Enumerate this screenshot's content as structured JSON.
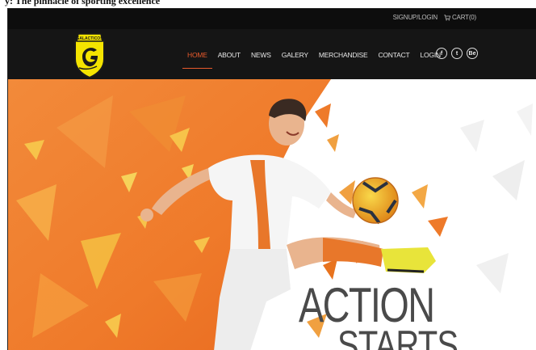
{
  "caption": "y: The pinnacle of sporting excellence",
  "topbar": {
    "signup_label": "SIGNUP/LOGIN",
    "cart_label": "CART(0)",
    "cart_icon": "cart-icon"
  },
  "brand": {
    "logo_text": "GALACTICOS",
    "accent": "#e85a2c",
    "logo_color": "#f4e400"
  },
  "nav": {
    "items": [
      {
        "label": "HOME",
        "active": true
      },
      {
        "label": "ABOUT"
      },
      {
        "label": "NEWS"
      },
      {
        "label": "GALERY"
      },
      {
        "label": "MERCHANDISE"
      },
      {
        "label": "CONTACT"
      },
      {
        "label": "LOGIN"
      }
    ]
  },
  "social": {
    "facebook": "f",
    "twitter": "t",
    "behance": "Be"
  },
  "hero": {
    "headline": "ACTION",
    "subline": "STARTS"
  }
}
